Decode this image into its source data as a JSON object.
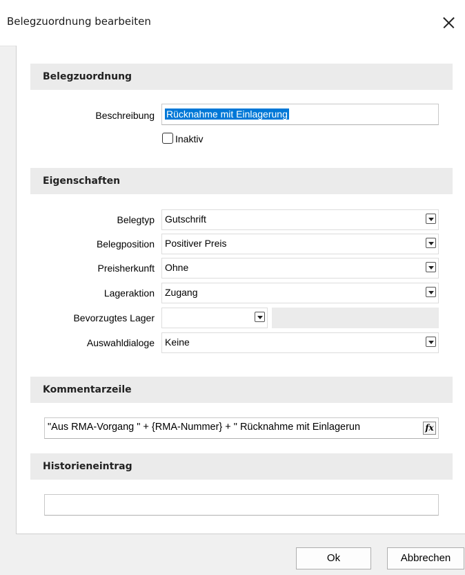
{
  "window": {
    "title": "Belegzuordnung bearbeiten"
  },
  "sections": {
    "belegzuordnung": "Belegzuordnung",
    "eigenschaften": "Eigenschaften",
    "kommentarzeile": "Kommentarzeile",
    "historieneintrag": "Historieneintrag"
  },
  "beschreibung": {
    "label": "Beschreibung",
    "value": "Rücknahme mit Einlagerung"
  },
  "inaktiv": {
    "label": "Inaktiv",
    "checked": false
  },
  "properties": {
    "belegtyp": {
      "label": "Belegtyp",
      "value": "Gutschrift"
    },
    "belegposition": {
      "label": "Belegposition",
      "value": "Positiver Preis"
    },
    "preisherkunft": {
      "label": "Preisherkunft",
      "value": "Ohne"
    },
    "lageraktion": {
      "label": "Lageraktion",
      "value": "Zugang"
    },
    "bevorzugtes_lager": {
      "label": "Bevorzugtes Lager",
      "value": ""
    },
    "auswahldialoge": {
      "label": "Auswahldialoge",
      "value": "Keine"
    }
  },
  "kommentar": {
    "value": "\"Aus RMA-Vorgang \" + {RMA-Nummer} + \" Rücknahme mit Einlagerun",
    "fx_label": "fx"
  },
  "historie": {
    "value": ""
  },
  "buttons": {
    "ok": "Ok",
    "cancel": "Abbrechen"
  }
}
